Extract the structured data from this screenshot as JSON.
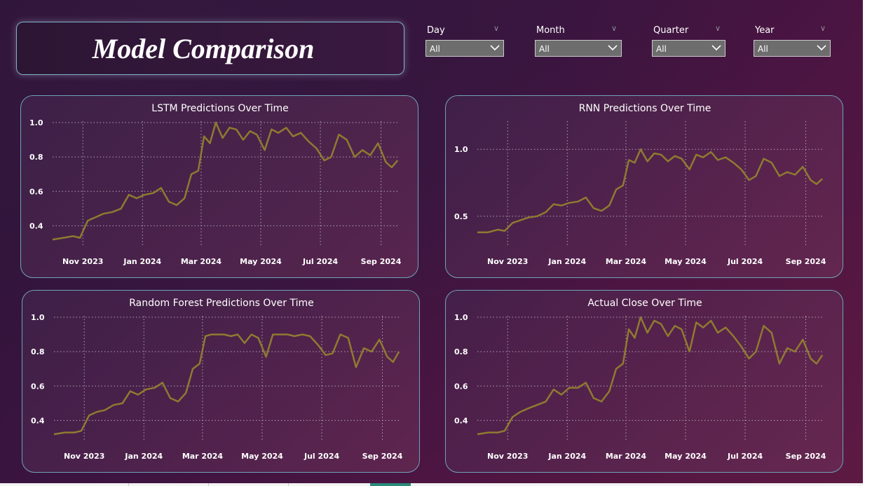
{
  "page": {
    "title": "Model Comparison"
  },
  "slicers": [
    {
      "label": "Day",
      "value": "All"
    },
    {
      "label": "Month",
      "value": "All"
    },
    {
      "label": "Quarter",
      "value": "All"
    },
    {
      "label": "Year",
      "value": "All"
    }
  ],
  "colors": {
    "line": "#8f7a30",
    "grid": "#c9c0cc",
    "text": "#ffffff"
  },
  "chart_data": [
    {
      "type": "line",
      "title": "LSTM Predictions Over Time",
      "xlabel": "",
      "ylabel": "",
      "x_ticks": [
        "Nov 2023",
        "Jan 2024",
        "Mar 2024",
        "May 2024",
        "Jul 2024",
        "Sep 2024"
      ],
      "y_ticks": [
        "0.4",
        "0.6",
        "0.8",
        "1.0"
      ],
      "ylim": [
        0.3,
        1.0
      ],
      "xlim": [
        "2023-10-01",
        "2024-09-20"
      ],
      "grid": true,
      "series": [
        {
          "x": [
            "2023-10-01",
            "2023-10-12",
            "2023-10-22",
            "2023-10-29",
            "2023-11-06",
            "2023-11-14",
            "2023-11-22",
            "2023-12-01",
            "2023-12-10",
            "2023-12-18",
            "2023-12-26",
            "2024-01-03",
            "2024-01-12",
            "2024-01-20",
            "2024-01-28",
            "2024-02-05",
            "2024-02-13",
            "2024-02-20",
            "2024-02-27",
            "2024-03-04",
            "2024-03-10",
            "2024-03-16",
            "2024-03-23",
            "2024-03-30",
            "2024-04-06",
            "2024-04-13",
            "2024-04-20",
            "2024-04-27",
            "2024-05-05",
            "2024-05-12",
            "2024-05-19",
            "2024-05-27",
            "2024-06-03",
            "2024-06-11",
            "2024-06-19",
            "2024-06-27",
            "2024-07-05",
            "2024-07-12",
            "2024-07-20",
            "2024-07-28",
            "2024-08-05",
            "2024-08-13",
            "2024-08-21",
            "2024-08-29",
            "2024-09-06",
            "2024-09-12",
            "2024-09-18"
          ],
          "y": [
            0.32,
            0.33,
            0.34,
            0.33,
            0.43,
            0.45,
            0.47,
            0.48,
            0.5,
            0.58,
            0.56,
            0.58,
            0.59,
            0.62,
            0.54,
            0.52,
            0.56,
            0.7,
            0.72,
            0.92,
            0.88,
            1.0,
            0.91,
            0.97,
            0.96,
            0.9,
            0.95,
            0.93,
            0.84,
            0.96,
            0.94,
            0.97,
            0.92,
            0.94,
            0.89,
            0.85,
            0.78,
            0.8,
            0.93,
            0.9,
            0.8,
            0.84,
            0.81,
            0.88,
            0.77,
            0.74,
            0.78
          ]
        }
      ]
    },
    {
      "type": "line",
      "title": "RNN Predictions Over Time",
      "xlabel": "",
      "ylabel": "",
      "x_ticks": [
        "Nov 2023",
        "Jan 2024",
        "Mar 2024",
        "May 2024",
        "Jul 2024",
        "Sep 2024"
      ],
      "y_ticks": [
        "0.5",
        "1.0"
      ],
      "ylim": [
        0.3,
        1.2
      ],
      "xlim": [
        "2023-10-01",
        "2024-09-20"
      ],
      "grid": true,
      "series": [
        {
          "x": [
            "2023-10-01",
            "2023-10-12",
            "2023-10-22",
            "2023-10-29",
            "2023-11-06",
            "2023-11-14",
            "2023-11-22",
            "2023-12-01",
            "2023-12-10",
            "2023-12-18",
            "2023-12-26",
            "2024-01-03",
            "2024-01-12",
            "2024-01-20",
            "2024-01-28",
            "2024-02-05",
            "2024-02-13",
            "2024-02-20",
            "2024-02-27",
            "2024-03-04",
            "2024-03-10",
            "2024-03-16",
            "2024-03-23",
            "2024-03-30",
            "2024-04-06",
            "2024-04-13",
            "2024-04-20",
            "2024-04-27",
            "2024-05-05",
            "2024-05-12",
            "2024-05-19",
            "2024-05-27",
            "2024-06-03",
            "2024-06-11",
            "2024-06-19",
            "2024-06-27",
            "2024-07-05",
            "2024-07-12",
            "2024-07-20",
            "2024-07-28",
            "2024-08-05",
            "2024-08-13",
            "2024-08-21",
            "2024-08-29",
            "2024-09-06",
            "2024-09-12",
            "2024-09-18"
          ],
          "y": [
            0.38,
            0.38,
            0.4,
            0.39,
            0.45,
            0.47,
            0.49,
            0.5,
            0.53,
            0.59,
            0.58,
            0.6,
            0.61,
            0.64,
            0.56,
            0.54,
            0.58,
            0.7,
            0.73,
            0.92,
            0.9,
            1.0,
            0.91,
            0.97,
            0.96,
            0.91,
            0.95,
            0.93,
            0.85,
            0.96,
            0.94,
            0.98,
            0.92,
            0.94,
            0.9,
            0.85,
            0.77,
            0.8,
            0.93,
            0.9,
            0.8,
            0.83,
            0.81,
            0.87,
            0.77,
            0.74,
            0.78
          ]
        }
      ]
    },
    {
      "type": "line",
      "title": "Random Forest Predictions Over Time",
      "xlabel": "",
      "ylabel": "",
      "x_ticks": [
        "Nov 2023",
        "Jan 2024",
        "Mar 2024",
        "May 2024",
        "Jul 2024",
        "Sep 2024"
      ],
      "y_ticks": [
        "0.4",
        "0.6",
        "0.8",
        "1.0"
      ],
      "ylim": [
        0.3,
        1.0
      ],
      "xlim": [
        "2023-10-01",
        "2024-09-20"
      ],
      "grid": true,
      "series": [
        {
          "x": [
            "2023-10-01",
            "2023-10-12",
            "2023-10-22",
            "2023-10-29",
            "2023-11-06",
            "2023-11-14",
            "2023-11-22",
            "2023-12-01",
            "2023-12-10",
            "2023-12-18",
            "2023-12-26",
            "2024-01-03",
            "2024-01-12",
            "2024-01-20",
            "2024-01-28",
            "2024-02-05",
            "2024-02-13",
            "2024-02-20",
            "2024-02-27",
            "2024-03-04",
            "2024-03-10",
            "2024-03-16",
            "2024-03-23",
            "2024-03-30",
            "2024-04-06",
            "2024-04-13",
            "2024-04-20",
            "2024-04-27",
            "2024-05-05",
            "2024-05-12",
            "2024-05-19",
            "2024-05-27",
            "2024-06-03",
            "2024-06-11",
            "2024-06-19",
            "2024-06-27",
            "2024-07-05",
            "2024-07-12",
            "2024-07-20",
            "2024-07-28",
            "2024-08-05",
            "2024-08-13",
            "2024-08-21",
            "2024-08-29",
            "2024-09-06",
            "2024-09-12",
            "2024-09-18"
          ],
          "y": [
            0.32,
            0.33,
            0.33,
            0.34,
            0.43,
            0.45,
            0.46,
            0.49,
            0.5,
            0.57,
            0.55,
            0.58,
            0.59,
            0.62,
            0.53,
            0.51,
            0.56,
            0.7,
            0.73,
            0.89,
            0.9,
            0.9,
            0.9,
            0.89,
            0.9,
            0.85,
            0.9,
            0.88,
            0.77,
            0.9,
            0.9,
            0.9,
            0.89,
            0.9,
            0.89,
            0.84,
            0.78,
            0.79,
            0.9,
            0.88,
            0.71,
            0.82,
            0.8,
            0.87,
            0.77,
            0.74,
            0.8
          ]
        }
      ]
    },
    {
      "type": "line",
      "title": "Actual Close Over Time",
      "xlabel": "",
      "ylabel": "",
      "x_ticks": [
        "Nov 2023",
        "Jan 2024",
        "Mar 2024",
        "May 2024",
        "Jul 2024",
        "Sep 2024"
      ],
      "y_ticks": [
        "0.4",
        "0.6",
        "0.8",
        "1.0"
      ],
      "ylim": [
        0.3,
        1.0
      ],
      "xlim": [
        "2023-10-01",
        "2024-09-20"
      ],
      "grid": true,
      "series": [
        {
          "x": [
            "2023-10-01",
            "2023-10-12",
            "2023-10-22",
            "2023-10-29",
            "2023-11-06",
            "2023-11-14",
            "2023-11-22",
            "2023-12-01",
            "2023-12-10",
            "2023-12-18",
            "2023-12-26",
            "2024-01-03",
            "2024-01-12",
            "2024-01-20",
            "2024-01-28",
            "2024-02-05",
            "2024-02-13",
            "2024-02-20",
            "2024-02-27",
            "2024-03-04",
            "2024-03-10",
            "2024-03-16",
            "2024-03-23",
            "2024-03-30",
            "2024-04-06",
            "2024-04-13",
            "2024-04-20",
            "2024-04-27",
            "2024-05-05",
            "2024-05-12",
            "2024-05-19",
            "2024-05-27",
            "2024-06-03",
            "2024-06-11",
            "2024-06-19",
            "2024-06-27",
            "2024-07-05",
            "2024-07-12",
            "2024-07-20",
            "2024-07-28",
            "2024-08-05",
            "2024-08-13",
            "2024-08-21",
            "2024-08-29",
            "2024-09-06",
            "2024-09-12",
            "2024-09-18"
          ],
          "y": [
            0.32,
            0.33,
            0.33,
            0.34,
            0.42,
            0.45,
            0.47,
            0.49,
            0.51,
            0.58,
            0.55,
            0.59,
            0.59,
            0.62,
            0.53,
            0.51,
            0.57,
            0.7,
            0.73,
            0.93,
            0.88,
            1.0,
            0.91,
            0.98,
            0.96,
            0.89,
            0.95,
            0.93,
            0.8,
            0.97,
            0.94,
            0.98,
            0.91,
            0.94,
            0.89,
            0.83,
            0.76,
            0.8,
            0.95,
            0.91,
            0.73,
            0.82,
            0.8,
            0.87,
            0.76,
            0.73,
            0.78
          ]
        }
      ]
    }
  ]
}
